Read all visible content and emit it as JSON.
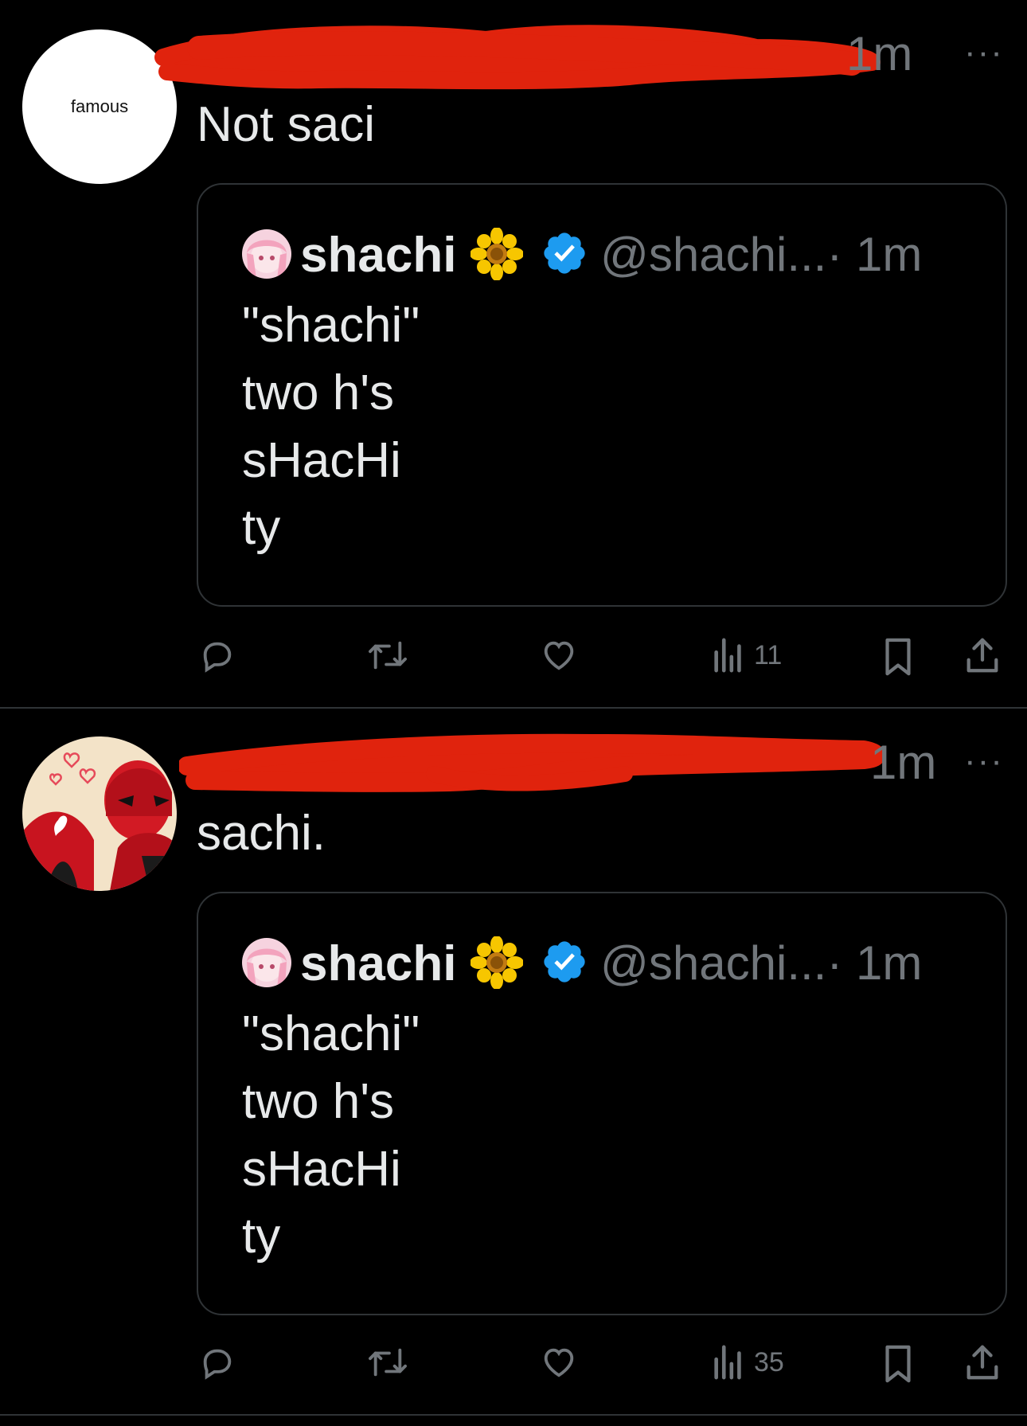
{
  "tweets": [
    {
      "avatar_text": "famous",
      "time": "1m",
      "more": "···",
      "text": "Not saci",
      "quote": {
        "name": "shachi",
        "handle": "@shachi...",
        "time": "· 1m",
        "lines": [
          "\"shachi\"",
          "two h's",
          "sHacHi",
          "ty"
        ]
      },
      "actions": {
        "views": "11"
      }
    },
    {
      "time": "1m",
      "more": "···",
      "text": "sachi.",
      "quote": {
        "name": "shachi",
        "handle": "@shachi...",
        "time": "· 1m",
        "lines": [
          "\"shachi\"",
          "two h's",
          "sHacHi",
          "ty"
        ]
      },
      "actions": {
        "views": "35"
      }
    }
  ],
  "icons": {
    "reply": "reply-icon",
    "retweet": "retweet-icon",
    "like": "heart-icon",
    "views": "views-icon",
    "bookmark": "bookmark-icon",
    "share": "share-icon",
    "verified": "verified-badge-icon",
    "flower": "sunflower-emoji-icon"
  },
  "colors": {
    "background": "#000000",
    "text": "#e7e9ea",
    "muted": "#71767b",
    "verified": "#1d9bf0",
    "redaction": "#e0230d"
  }
}
